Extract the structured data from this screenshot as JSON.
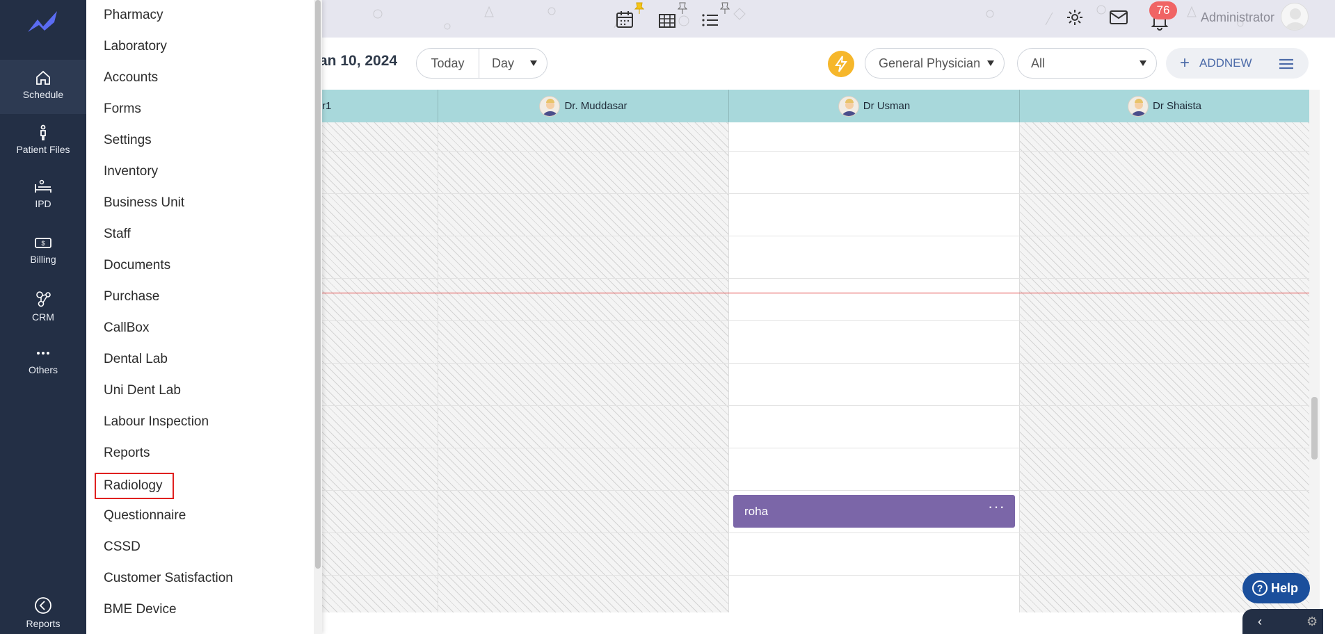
{
  "rail": {
    "items": [
      {
        "label": "Schedule",
        "icon": "home-icon"
      },
      {
        "label": "Patient Files",
        "icon": "person-icon"
      },
      {
        "label": "IPD",
        "icon": "bed-icon"
      },
      {
        "label": "Billing",
        "icon": "cash-icon"
      },
      {
        "label": "CRM",
        "icon": "network-icon"
      },
      {
        "label": "Others",
        "icon": "more-icon"
      },
      {
        "label": "Reports",
        "icon": "back-circle-icon"
      }
    ]
  },
  "drawer": {
    "items": [
      "Pharmacy",
      "Laboratory",
      "Accounts",
      "Forms",
      "Settings",
      "Inventory",
      "Business Unit",
      "Staff",
      "Documents",
      "Purchase",
      "CallBox",
      "Dental Lab",
      "Uni Dent Lab",
      "Labour Inspection",
      "Reports",
      "Radiology",
      "Questionnaire",
      "CSSD",
      "Customer Satisfaction",
      "BME Device"
    ],
    "selected": "Radiology"
  },
  "topbar": {
    "notification_count": "76",
    "user_name": "Administrator"
  },
  "toolbar": {
    "date": "an 10, 2024",
    "today_label": "Today",
    "view_label": "Day",
    "specialty": "General Physician",
    "filter": "All",
    "addnew_plus": "+",
    "addnew_label": "ADDNEW"
  },
  "calendar": {
    "columns": [
      {
        "name": "r1"
      },
      {
        "name": "Dr. Muddasar"
      },
      {
        "name": "Dr Usman"
      },
      {
        "name": "Dr Shaista"
      }
    ],
    "appointment": {
      "patient": "roha",
      "menu": "···"
    }
  },
  "help": {
    "label": "Help",
    "q": "?"
  },
  "footer": {
    "chevron": "‹",
    "gear": "⚙"
  },
  "colors": {
    "rail": "#232f45",
    "header": "#a8d8db",
    "appointment": "#7b66a8",
    "badge": "#f06464",
    "now_line": "#e03a3a",
    "help": "#1b4f9c"
  }
}
